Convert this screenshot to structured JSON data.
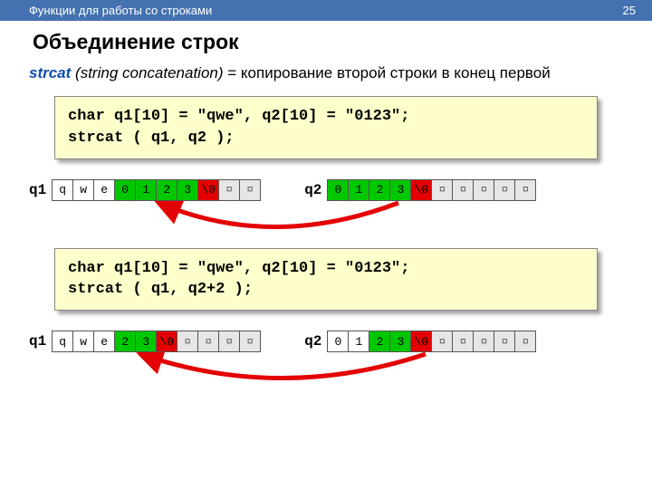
{
  "header": {
    "topic": "Функции для работы со строками",
    "page": "25"
  },
  "title": "Объединение строк",
  "desc": {
    "fn": "strcat",
    "paren": "(string concatenation)",
    "rest": " = копирование второй строки в конец первой"
  },
  "code1": {
    "line1": "char q1[10] = \"qwe\", q2[10] = \"0123\";",
    "line2": "strcat ( q1, q2 );"
  },
  "code2": {
    "line1": "char q1[10] = \"qwe\", q2[10] = \"0123\";",
    "line2": "strcat ( q1, q2+2 );"
  },
  "labels": {
    "q1": "q1",
    "q2": "q2"
  },
  "ex1": {
    "q1": [
      {
        "v": "q",
        "c": "c-white"
      },
      {
        "v": "w",
        "c": "c-white"
      },
      {
        "v": "e",
        "c": "c-white"
      },
      {
        "v": "0",
        "c": "c-green"
      },
      {
        "v": "1",
        "c": "c-green"
      },
      {
        "v": "2",
        "c": "c-green"
      },
      {
        "v": "3",
        "c": "c-green"
      },
      {
        "v": "\\0",
        "c": "c-red"
      },
      {
        "v": "¤",
        "c": "c-gray"
      },
      {
        "v": "¤",
        "c": "c-gray"
      }
    ],
    "q2": [
      {
        "v": "0",
        "c": "c-green"
      },
      {
        "v": "1",
        "c": "c-green"
      },
      {
        "v": "2",
        "c": "c-green"
      },
      {
        "v": "3",
        "c": "c-green"
      },
      {
        "v": "\\0",
        "c": "c-red"
      },
      {
        "v": "¤",
        "c": "c-gray"
      },
      {
        "v": "¤",
        "c": "c-gray"
      },
      {
        "v": "¤",
        "c": "c-gray"
      },
      {
        "v": "¤",
        "c": "c-gray"
      },
      {
        "v": "¤",
        "c": "c-gray"
      }
    ]
  },
  "ex2": {
    "q1": [
      {
        "v": "q",
        "c": "c-white"
      },
      {
        "v": "w",
        "c": "c-white"
      },
      {
        "v": "e",
        "c": "c-white"
      },
      {
        "v": "2",
        "c": "c-green"
      },
      {
        "v": "3",
        "c": "c-green"
      },
      {
        "v": "\\0",
        "c": "c-red"
      },
      {
        "v": "¤",
        "c": "c-gray"
      },
      {
        "v": "¤",
        "c": "c-gray"
      },
      {
        "v": "¤",
        "c": "c-gray"
      },
      {
        "v": "¤",
        "c": "c-gray"
      }
    ],
    "q2": [
      {
        "v": "0",
        "c": "c-white"
      },
      {
        "v": "1",
        "c": "c-white"
      },
      {
        "v": "2",
        "c": "c-green"
      },
      {
        "v": "3",
        "c": "c-green"
      },
      {
        "v": "\\0",
        "c": "c-red"
      },
      {
        "v": "¤",
        "c": "c-gray"
      },
      {
        "v": "¤",
        "c": "c-gray"
      },
      {
        "v": "¤",
        "c": "c-gray"
      },
      {
        "v": "¤",
        "c": "c-gray"
      },
      {
        "v": "¤",
        "c": "c-gray"
      }
    ]
  }
}
